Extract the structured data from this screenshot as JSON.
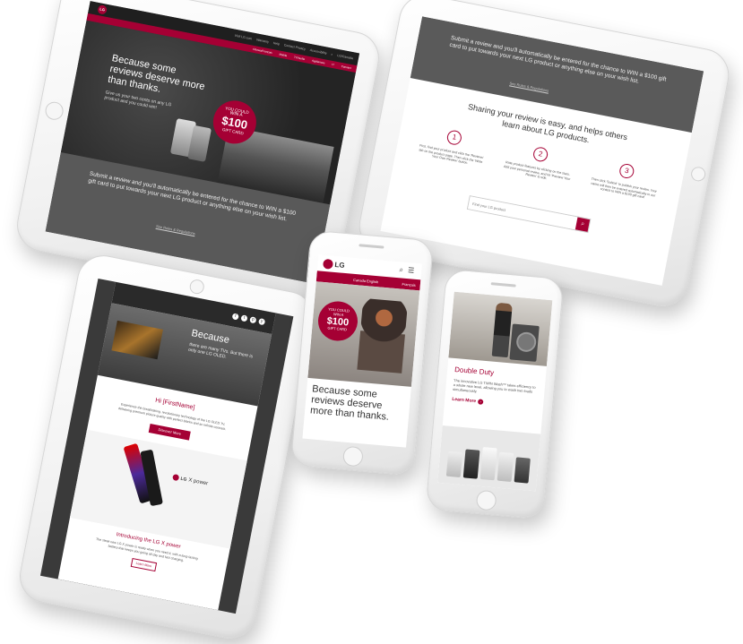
{
  "tablet1": {
    "logo": "LG",
    "nav_links": [
      "Visit LG.com",
      "Warranty",
      "Help",
      "Contact Privacy",
      "Accessibility"
    ],
    "nav_right": "LG/Canada",
    "sub_nav": [
      "Ottawa/Français",
      "Mobile",
      "TV/Audio",
      "Appliances",
      "IT",
      "Connect"
    ],
    "headline": "Because some reviews deserve more than thanks.",
    "subhead": "Give us your two cents on any LG product and you could win!",
    "badge_line1": "YOU COULD",
    "badge_line2": "WIN A",
    "badge_amount": "$100",
    "badge_line4": "GIFT CARD",
    "footer_text": "Submit a review and you'll automatically be entered for the chance to WIN a $100 gift card to put towards your next LG product or anything else on your wish list.",
    "footer_link": "See Rules & Regulations"
  },
  "tablet2": {
    "top_text": "Submit a review and you'll automatically be entered for the chance to WIN a $100 gift card to put towards your next LG product or anything else on your wish list.",
    "top_link": "See Rules & Regulations",
    "heading": "Sharing your review is easy, and helps others learn about LG products.",
    "steps": [
      {
        "num": "1",
        "text": "First, find your product and click the 'Reviews' tab on the product page. Then click the 'Write Your Own Review' button."
      },
      {
        "num": "2",
        "text": "Rate product features by clicking on the stars. Add your personal review, and hit 'Preview Your Review' to edit."
      },
      {
        "num": "3",
        "text": "Then click 'Submit' to publish your review. Your name will then be entered automatically in our contest to WIN a $100 gift card!"
      }
    ],
    "search_placeholder": "Find your LG product"
  },
  "tablet3": {
    "social": [
      "f",
      "t",
      "p",
      "y"
    ],
    "hero_text1": "Because",
    "hero_text2": "there are many TVs. But there is only one LG OLED.",
    "greeting": "Hi [FirstName]",
    "body_text": "Experience the breathtaking, revolutionary technology of the LG OLED TV, delivering premium picture quality with perfect blacks and an infinite contrast.",
    "cta": "Discover More",
    "product_logo": "LG",
    "product_name": "X power",
    "intro_heading": "Introducing the LG X power",
    "intro_text": "The sleek new LG X power is ready when you need it, with a long-lasting battery that keeps you going all day and fast charging.",
    "learn_more": "Learn More"
  },
  "phone1": {
    "logo": "LG",
    "lang_left": "Canada English",
    "lang_right": "Français",
    "badge_line1": "YOU COULD",
    "badge_line2": "WIN A",
    "badge_amount": "$100",
    "badge_line4": "GIFT CARD",
    "headline": "Because some reviews deserve more than thanks."
  },
  "phone2": {
    "title": "Double Duty",
    "body": "The innovative LG TWIN Wash™ takes efficiency to a whole new level, allowing you to wash two loads simultaneously.",
    "link": "Learn More"
  },
  "colors": {
    "brand": "#a50034",
    "dark": "#3a3a3a",
    "grey": "#5a5a5a"
  }
}
